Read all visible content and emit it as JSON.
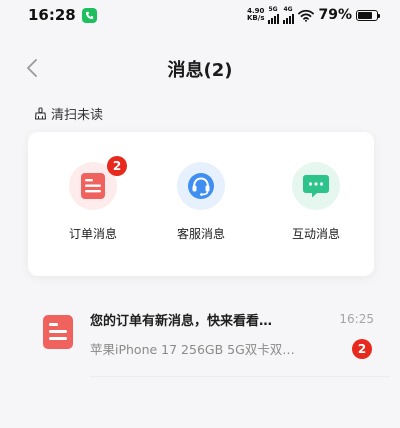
{
  "status_bar": {
    "time": "16:28",
    "speed_value": "4.90",
    "speed_unit": "KB/s",
    "sig1": "5G",
    "sig2": "4G",
    "battery": "79%"
  },
  "nav": {
    "title": "消息(2)"
  },
  "clear_unread": {
    "label": "清扫未读"
  },
  "categories": [
    {
      "label": "订单消息",
      "icon": "order-icon",
      "badge": "2",
      "color": "#f0625e"
    },
    {
      "label": "客服消息",
      "icon": "customer-service-icon",
      "color": "#3f8ff2"
    },
    {
      "label": "互动消息",
      "icon": "chat-bubble-icon",
      "color": "#2cc48b"
    }
  ],
  "messages": [
    {
      "title": "您的订单有新消息，快来看看…",
      "preview": "苹果iPhone 17 256GB 5G双卡双…",
      "time": "16:25",
      "badge": "2",
      "icon": "order-icon"
    }
  ],
  "colors": {
    "badge": "#e8291d",
    "background": "#f6f6f8"
  }
}
